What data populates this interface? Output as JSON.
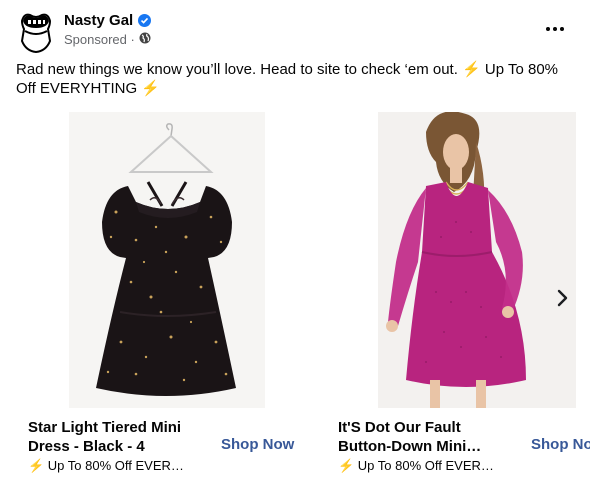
{
  "header": {
    "page_name": "Nasty Gal",
    "sponsored": "Sponsored ·"
  },
  "post": {
    "text": "Rad new things we know you’ll love. Head to site to check ‘em out. ⚡ Up To 80% Off EVERYHTING ⚡"
  },
  "cards": [
    {
      "title": "Star Light Tiered Mini Dress - Black - 4",
      "description": "⚡ Up To 80% Off EVER…",
      "cta": "Shop Now"
    },
    {
      "title": "It'S Dot Our Fault Button-Down Mini…",
      "description": "⚡ Up To 80% Off EVER…",
      "cta": "Shop Now"
    }
  ],
  "colors": {
    "link": "#385898",
    "verified": "#1877f2",
    "muted": "#65676b",
    "dress1": "#1a1416",
    "dress2": "#b8247f"
  },
  "icons": {
    "verified": "verified-badge-icon",
    "globe": "globe-icon",
    "more": "more-options-icon",
    "next": "chevron-right-icon"
  }
}
